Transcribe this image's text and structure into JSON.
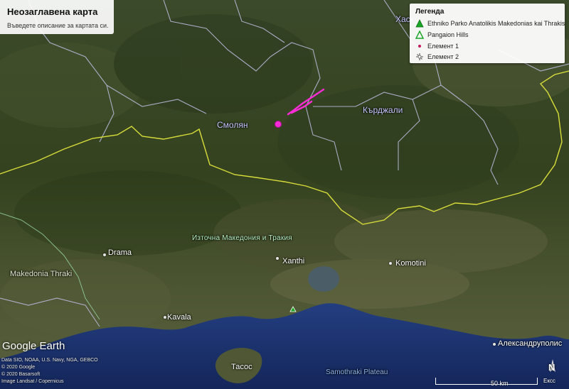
{
  "map": {
    "title": "Неозаглавена карта",
    "description": "Въведете описание за картата си."
  },
  "legend": {
    "title": "Легенда",
    "items": [
      {
        "label": "Ethniko Parko Anatolikis Makedonias kai Thrakis",
        "icon": "green-triangle-icon",
        "color": "#1aa526"
      },
      {
        "label": "Pangaion Hills",
        "icon": "green-triangle-icon",
        "color": "#1aa526"
      },
      {
        "label": "Елемент 1",
        "icon": "point-icon",
        "color": "#c2185b"
      },
      {
        "label": "Елемент 2",
        "icon": "line-icon",
        "color": "#555555"
      }
    ]
  },
  "places": {
    "haskovo": "Хаск",
    "kardzhali": "Кърджали",
    "smolyan": "Смолян",
    "region": "Източна Македония и Тракия",
    "drama": "Drama",
    "makedonia_thraki": "Makedonia Thraki",
    "xanthi": "Xanthi",
    "komotini": "Komotini",
    "kavala": "Kavala",
    "thasos": "Тасос",
    "alexandroupolis": "Александруполис",
    "sea": "Samothraki Plateau"
  },
  "branding": {
    "logo": "Google Earth",
    "attribution": [
      "Data SIO, NOAA, U.S. Navy, NGA, GEBCO",
      "© 2020 Google",
      "© 2020 Basarsoft",
      "Image Landsat / Copernicus"
    ]
  },
  "scale": {
    "label": "50 km"
  },
  "compass": {
    "north": "N",
    "label": "Ексс"
  },
  "colors": {
    "border": "#d8dd3a",
    "admin": "#b8b8d8",
    "drawn_line": "#ff2bd6",
    "sea": "#1b2f66"
  }
}
